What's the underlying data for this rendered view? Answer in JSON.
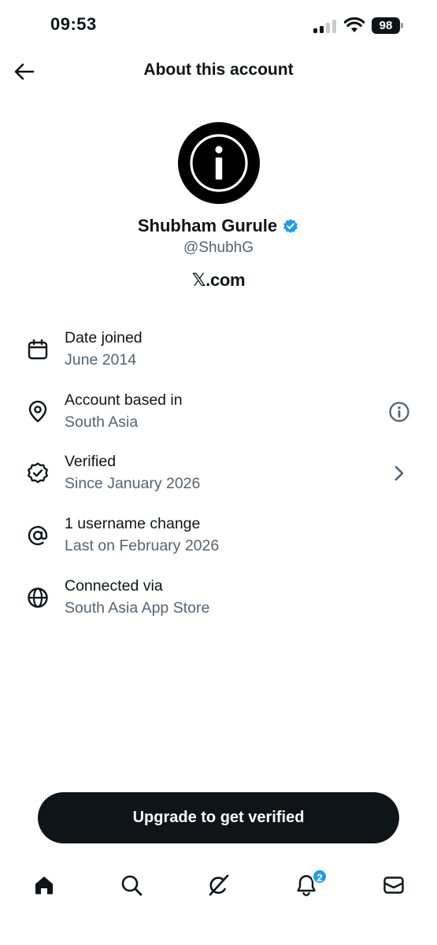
{
  "status_bar": {
    "time": "09:53",
    "battery": "98"
  },
  "header": {
    "back_icon": "arrow-left-icon",
    "title": "About this account"
  },
  "profile": {
    "avatar_icon": "info-icon",
    "display_name": "Shubham Gurule",
    "verified_icon": "verified-badge-icon",
    "handle": "@ShubhG",
    "site": "𝕏.com"
  },
  "details": [
    {
      "icon": "calendar-icon",
      "title": "Date joined",
      "subtitle": "June 2014"
    },
    {
      "icon": "location-pin-icon",
      "title": "Account based in",
      "subtitle": "South Asia",
      "trailing": "info-circle-icon"
    },
    {
      "icon": "verified-outline-icon",
      "title": "Verified",
      "subtitle": "Since January 2026",
      "trailing": "chevron-right-icon"
    },
    {
      "icon": "at-sign-icon",
      "title": "1 username change",
      "subtitle": "Last on February 2026"
    },
    {
      "icon": "globe-icon",
      "title": "Connected via",
      "subtitle": "South Asia App Store"
    }
  ],
  "cta": {
    "label": "Upgrade to get verified"
  },
  "tabbar": {
    "items": [
      "home-icon",
      "search-icon",
      "grok-icon",
      "notifications-bell-icon",
      "messages-mail-icon"
    ],
    "notifications_badge": "2"
  },
  "colors": {
    "text_primary": "#0f1419",
    "text_secondary": "#536471",
    "accent_blue": "#1d9bf0",
    "cta_background": "#0f1419"
  }
}
